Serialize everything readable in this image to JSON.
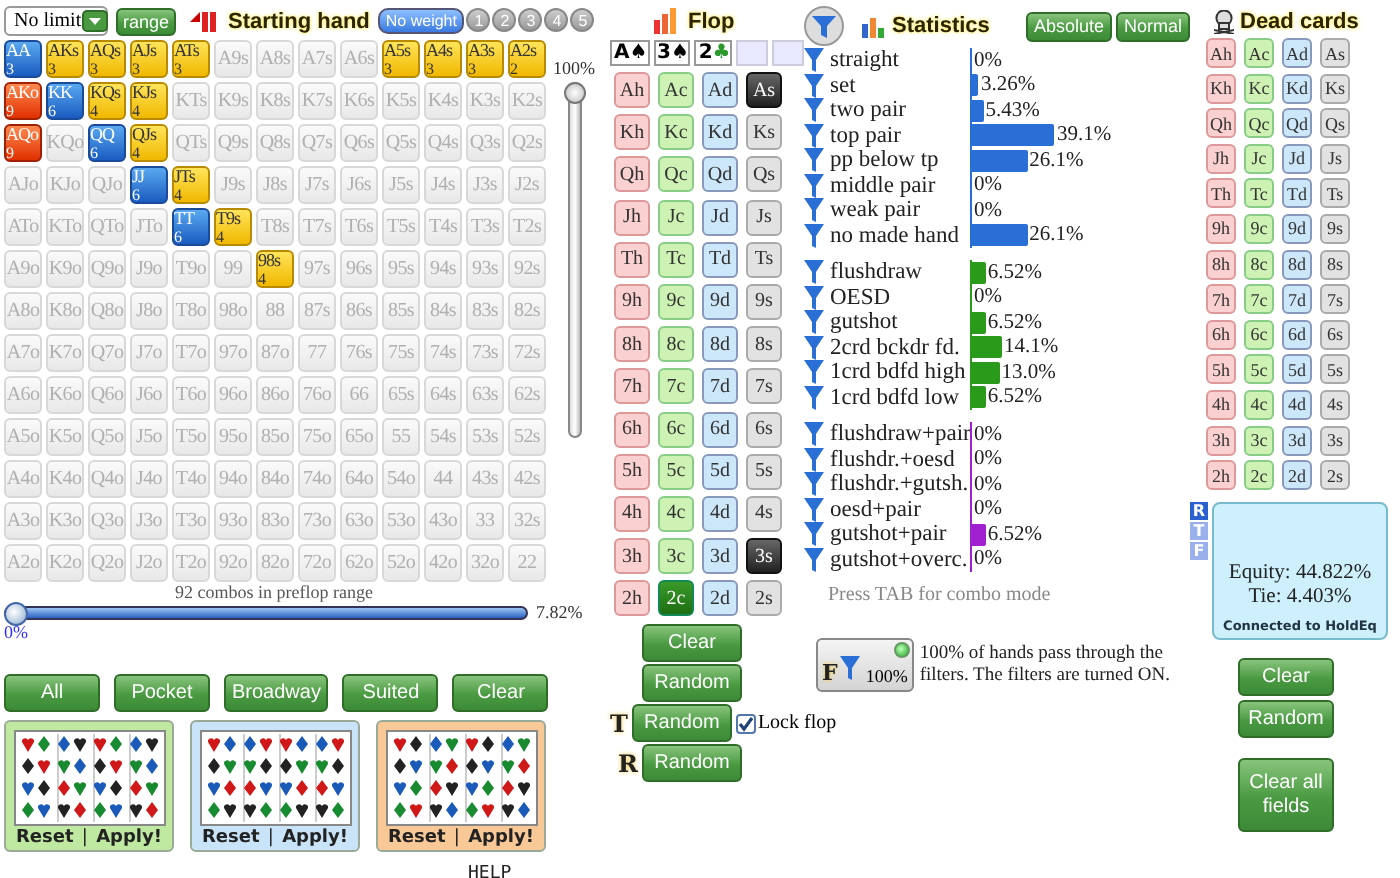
{
  "range": {
    "game": "No limit",
    "range_button": "range",
    "title": "Starting hand",
    "weights": [
      {
        "label": "No weight",
        "selected": true
      },
      {
        "label": "1",
        "selected": false
      },
      {
        "label": "2",
        "selected": false
      },
      {
        "label": "3",
        "selected": false
      },
      {
        "label": "4",
        "selected": false
      },
      {
        "label": "5",
        "selected": false
      }
    ],
    "grid": [
      [
        {
          "label": "AA",
          "selected": true,
          "count": "3"
        },
        {
          "label": "AKs",
          "selected": true,
          "count": "3"
        },
        {
          "label": "AQs",
          "selected": true,
          "count": "3"
        },
        {
          "label": "AJs",
          "selected": true,
          "count": "3"
        },
        {
          "label": "ATs",
          "selected": true,
          "count": "3"
        },
        {
          "label": "A9s",
          "selected": false
        },
        {
          "label": "A8s",
          "selected": false
        },
        {
          "label": "A7s",
          "selected": false
        },
        {
          "label": "A6s",
          "selected": false
        },
        {
          "label": "A5s",
          "selected": true,
          "count": "3"
        },
        {
          "label": "A4s",
          "selected": true,
          "count": "3"
        },
        {
          "label": "A3s",
          "selected": true,
          "count": "3"
        },
        {
          "label": "A2s",
          "selected": true,
          "count": "2"
        }
      ],
      [
        {
          "label": "AKo",
          "selected": true,
          "count": "9"
        },
        {
          "label": "KK",
          "selected": true,
          "count": "6"
        },
        {
          "label": "KQs",
          "selected": true,
          "count": "4"
        },
        {
          "label": "KJs",
          "selected": true,
          "count": "4"
        },
        {
          "label": "KTs",
          "selected": false
        },
        {
          "label": "K9s",
          "selected": false
        },
        {
          "label": "K8s",
          "selected": false
        },
        {
          "label": "K7s",
          "selected": false
        },
        {
          "label": "K6s",
          "selected": false
        },
        {
          "label": "K5s",
          "selected": false
        },
        {
          "label": "K4s",
          "selected": false
        },
        {
          "label": "K3s",
          "selected": false
        },
        {
          "label": "K2s",
          "selected": false
        }
      ],
      [
        {
          "label": "AQo",
          "selected": true,
          "count": "9"
        },
        {
          "label": "KQo",
          "selected": false
        },
        {
          "label": "QQ",
          "selected": true,
          "count": "6"
        },
        {
          "label": "QJs",
          "selected": true,
          "count": "4"
        },
        {
          "label": "QTs",
          "selected": false
        },
        {
          "label": "Q9s",
          "selected": false
        },
        {
          "label": "Q8s",
          "selected": false
        },
        {
          "label": "Q7s",
          "selected": false
        },
        {
          "label": "Q6s",
          "selected": false
        },
        {
          "label": "Q5s",
          "selected": false
        },
        {
          "label": "Q4s",
          "selected": false
        },
        {
          "label": "Q3s",
          "selected": false
        },
        {
          "label": "Q2s",
          "selected": false
        }
      ],
      [
        {
          "label": "AJo",
          "selected": false
        },
        {
          "label": "KJo",
          "selected": false
        },
        {
          "label": "QJo",
          "selected": false
        },
        {
          "label": "JJ",
          "selected": true,
          "count": "6"
        },
        {
          "label": "JTs",
          "selected": true,
          "count": "4"
        },
        {
          "label": "J9s",
          "selected": false
        },
        {
          "label": "J8s",
          "selected": false
        },
        {
          "label": "J7s",
          "selected": false
        },
        {
          "label": "J6s",
          "selected": false
        },
        {
          "label": "J5s",
          "selected": false
        },
        {
          "label": "J4s",
          "selected": false
        },
        {
          "label": "J3s",
          "selected": false
        },
        {
          "label": "J2s",
          "selected": false
        }
      ],
      [
        {
          "label": "ATo",
          "selected": false
        },
        {
          "label": "KTo",
          "selected": false
        },
        {
          "label": "QTo",
          "selected": false
        },
        {
          "label": "JTo",
          "selected": false
        },
        {
          "label": "TT",
          "selected": true,
          "count": "6"
        },
        {
          "label": "T9s",
          "selected": true,
          "count": "4"
        },
        {
          "label": "T8s",
          "selected": false
        },
        {
          "label": "T7s",
          "selected": false
        },
        {
          "label": "T6s",
          "selected": false
        },
        {
          "label": "T5s",
          "selected": false
        },
        {
          "label": "T4s",
          "selected": false
        },
        {
          "label": "T3s",
          "selected": false
        },
        {
          "label": "T2s",
          "selected": false
        }
      ],
      [
        {
          "label": "A9o",
          "selected": false
        },
        {
          "label": "K9o",
          "selected": false
        },
        {
          "label": "Q9o",
          "selected": false
        },
        {
          "label": "J9o",
          "selected": false
        },
        {
          "label": "T9o",
          "selected": false
        },
        {
          "label": "99",
          "selected": false
        },
        {
          "label": "98s",
          "selected": true,
          "count": "4"
        },
        {
          "label": "97s",
          "selected": false
        },
        {
          "label": "96s",
          "selected": false
        },
        {
          "label": "95s",
          "selected": false
        },
        {
          "label": "94s",
          "selected": false
        },
        {
          "label": "93s",
          "selected": false
        },
        {
          "label": "92s",
          "selected": false
        }
      ],
      [
        {
          "label": "A8o",
          "selected": false
        },
        {
          "label": "K8o",
          "selected": false
        },
        {
          "label": "Q8o",
          "selected": false
        },
        {
          "label": "J8o",
          "selected": false
        },
        {
          "label": "T8o",
          "selected": false
        },
        {
          "label": "98o",
          "selected": false
        },
        {
          "label": "88",
          "selected": false
        },
        {
          "label": "87s",
          "selected": false
        },
        {
          "label": "86s",
          "selected": false
        },
        {
          "label": "85s",
          "selected": false
        },
        {
          "label": "84s",
          "selected": false
        },
        {
          "label": "83s",
          "selected": false
        },
        {
          "label": "82s",
          "selected": false
        }
      ],
      [
        {
          "label": "A7o",
          "selected": false
        },
        {
          "label": "K7o",
          "selected": false
        },
        {
          "label": "Q7o",
          "selected": false
        },
        {
          "label": "J7o",
          "selected": false
        },
        {
          "label": "T7o",
          "selected": false
        },
        {
          "label": "97o",
          "selected": false
        },
        {
          "label": "87o",
          "selected": false
        },
        {
          "label": "77",
          "selected": false
        },
        {
          "label": "76s",
          "selected": false
        },
        {
          "label": "75s",
          "selected": false
        },
        {
          "label": "74s",
          "selected": false
        },
        {
          "label": "73s",
          "selected": false
        },
        {
          "label": "72s",
          "selected": false
        }
      ],
      [
        {
          "label": "A6o",
          "selected": false
        },
        {
          "label": "K6o",
          "selected": false
        },
        {
          "label": "Q6o",
          "selected": false
        },
        {
          "label": "J6o",
          "selected": false
        },
        {
          "label": "T6o",
          "selected": false
        },
        {
          "label": "96o",
          "selected": false
        },
        {
          "label": "86o",
          "selected": false
        },
        {
          "label": "76o",
          "selected": false
        },
        {
          "label": "66",
          "selected": false
        },
        {
          "label": "65s",
          "selected": false
        },
        {
          "label": "64s",
          "selected": false
        },
        {
          "label": "63s",
          "selected": false
        },
        {
          "label": "62s",
          "selected": false
        }
      ],
      [
        {
          "label": "A5o",
          "selected": false
        },
        {
          "label": "K5o",
          "selected": false
        },
        {
          "label": "Q5o",
          "selected": false
        },
        {
          "label": "J5o",
          "selected": false
        },
        {
          "label": "T5o",
          "selected": false
        },
        {
          "label": "95o",
          "selected": false
        },
        {
          "label": "85o",
          "selected": false
        },
        {
          "label": "75o",
          "selected": false
        },
        {
          "label": "65o",
          "selected": false
        },
        {
          "label": "55",
          "selected": false
        },
        {
          "label": "54s",
          "selected": false
        },
        {
          "label": "53s",
          "selected": false
        },
        {
          "label": "52s",
          "selected": false
        }
      ],
      [
        {
          "label": "A4o",
          "selected": false
        },
        {
          "label": "K4o",
          "selected": false
        },
        {
          "label": "Q4o",
          "selected": false
        },
        {
          "label": "J4o",
          "selected": false
        },
        {
          "label": "T4o",
          "selected": false
        },
        {
          "label": "94o",
          "selected": false
        },
        {
          "label": "84o",
          "selected": false
        },
        {
          "label": "74o",
          "selected": false
        },
        {
          "label": "64o",
          "selected": false
        },
        {
          "label": "54o",
          "selected": false
        },
        {
          "label": "44",
          "selected": false
        },
        {
          "label": "43s",
          "selected": false
        },
        {
          "label": "42s",
          "selected": false
        }
      ],
      [
        {
          "label": "A3o",
          "selected": false
        },
        {
          "label": "K3o",
          "selected": false
        },
        {
          "label": "Q3o",
          "selected": false
        },
        {
          "label": "J3o",
          "selected": false
        },
        {
          "label": "T3o",
          "selected": false
        },
        {
          "label": "93o",
          "selected": false
        },
        {
          "label": "83o",
          "selected": false
        },
        {
          "label": "73o",
          "selected": false
        },
        {
          "label": "63o",
          "selected": false
        },
        {
          "label": "53o",
          "selected": false
        },
        {
          "label": "43o",
          "selected": false
        },
        {
          "label": "33",
          "selected": false
        },
        {
          "label": "32s",
          "selected": false
        }
      ],
      [
        {
          "label": "A2o",
          "selected": false
        },
        {
          "label": "K2o",
          "selected": false
        },
        {
          "label": "Q2o",
          "selected": false
        },
        {
          "label": "J2o",
          "selected": false
        },
        {
          "label": "T2o",
          "selected": false
        },
        {
          "label": "92o",
          "selected": false
        },
        {
          "label": "82o",
          "selected": false
        },
        {
          "label": "72o",
          "selected": false
        },
        {
          "label": "62o",
          "selected": false
        },
        {
          "label": "52o",
          "selected": false
        },
        {
          "label": "42o",
          "selected": false
        },
        {
          "label": "32o",
          "selected": false
        },
        {
          "label": "22",
          "selected": false
        }
      ]
    ],
    "vertical_slider": {
      "label": "100%",
      "level": 1
    },
    "combos": "92 combos in preflop range",
    "slider": {
      "level": 0,
      "min_label": "0%",
      "max_label": "7.82%"
    },
    "buttons": [
      "All",
      "Pocket",
      "Broadway",
      "Suited",
      "Clear"
    ],
    "presets": [
      {
        "color": "#bfe8a0",
        "reset": "Reset",
        "separator": "|",
        "apply": "Apply!"
      },
      {
        "color": "#c9e4f8",
        "reset": "Reset",
        "separator": "|",
        "apply": "Apply!"
      },
      {
        "color": "#f8c896",
        "reset": "Reset",
        "separator": "|",
        "apply": "Apply!"
      }
    ],
    "help": "HELP"
  },
  "flop": {
    "title": "Flop",
    "board": [
      {
        "kind": "card",
        "rank": "A",
        "suit": "♠",
        "color": "#000000"
      },
      {
        "kind": "card",
        "rank": "3",
        "suit": "♠",
        "color": "#000000"
      },
      {
        "kind": "card",
        "rank": "2",
        "suit": "♣",
        "color": "#2a9a2a"
      },
      {
        "kind": "empty"
      },
      {
        "kind": "empty"
      }
    ],
    "cards": [
      [
        {
          "label": "Ah",
          "selected": false
        },
        {
          "label": "Ac",
          "selected": false
        },
        {
          "label": "Ad",
          "selected": false
        },
        {
          "label": "As",
          "selected": true
        }
      ],
      [
        {
          "label": "Kh",
          "selected": false
        },
        {
          "label": "Kc",
          "selected": false
        },
        {
          "label": "Kd",
          "selected": false
        },
        {
          "label": "Ks",
          "selected": false
        }
      ],
      [
        {
          "label": "Qh",
          "selected": false
        },
        {
          "label": "Qc",
          "selected": false
        },
        {
          "label": "Qd",
          "selected": false
        },
        {
          "label": "Qs",
          "selected": false
        }
      ],
      [
        {
          "label": "Jh",
          "selected": false
        },
        {
          "label": "Jc",
          "selected": false
        },
        {
          "label": "Jd",
          "selected": false
        },
        {
          "label": "Js",
          "selected": false
        }
      ],
      [
        {
          "label": "Th",
          "selected": false
        },
        {
          "label": "Tc",
          "selected": false
        },
        {
          "label": "Td",
          "selected": false
        },
        {
          "label": "Ts",
          "selected": false
        }
      ],
      [
        {
          "label": "9h",
          "selected": false
        },
        {
          "label": "9c",
          "selected": false
        },
        {
          "label": "9d",
          "selected": false
        },
        {
          "label": "9s",
          "selected": false
        }
      ],
      [
        {
          "label": "8h",
          "selected": false
        },
        {
          "label": "8c",
          "selected": false
        },
        {
          "label": "8d",
          "selected": false
        },
        {
          "label": "8s",
          "selected": false
        }
      ],
      [
        {
          "label": "7h",
          "selected": false
        },
        {
          "label": "7c",
          "selected": false
        },
        {
          "label": "7d",
          "selected": false
        },
        {
          "label": "7s",
          "selected": false
        }
      ],
      [
        {
          "label": "6h",
          "selected": false
        },
        {
          "label": "6c",
          "selected": false
        },
        {
          "label": "6d",
          "selected": false
        },
        {
          "label": "6s",
          "selected": false
        }
      ],
      [
        {
          "label": "5h",
          "selected": false
        },
        {
          "label": "5c",
          "selected": false
        },
        {
          "label": "5d",
          "selected": false
        },
        {
          "label": "5s",
          "selected": false
        }
      ],
      [
        {
          "label": "4h",
          "selected": false
        },
        {
          "label": "4c",
          "selected": false
        },
        {
          "label": "4d",
          "selected": false
        },
        {
          "label": "4s",
          "selected": false
        }
      ],
      [
        {
          "label": "3h",
          "selected": false
        },
        {
          "label": "3c",
          "selected": false
        },
        {
          "label": "3d",
          "selected": false
        },
        {
          "label": "3s",
          "selected": true
        }
      ],
      [
        {
          "label": "2h",
          "selected": false
        },
        {
          "label": "2c",
          "selected": true
        },
        {
          "label": "2d",
          "selected": false
        },
        {
          "label": "2s",
          "selected": false
        }
      ]
    ],
    "clear": "Clear",
    "random": "Random",
    "turn": {
      "tag": "T",
      "label": "Random"
    },
    "river": {
      "tag": "R",
      "label": "Random"
    },
    "lock": {
      "label": "Lock flop",
      "checked": true
    }
  },
  "stats": {
    "title": "Statistics",
    "modes": [
      "Absolute",
      "Normal"
    ],
    "groups": [
      {
        "color": "#2a6fd6",
        "rows": [
          {
            "label": "straight",
            "value": "0%",
            "level": 0
          },
          {
            "label": "set",
            "value": "3.26%",
            "level": 0.0326
          },
          {
            "label": "two pair",
            "value": "5.43%",
            "level": 0.0543
          },
          {
            "label": "top pair",
            "value": "39.1%",
            "level": 0.391
          },
          {
            "label": "pp below tp",
            "value": "26.1%",
            "level": 0.261
          },
          {
            "label": "middle pair",
            "value": "0%",
            "level": 0
          },
          {
            "label": "weak pair",
            "value": "0%",
            "level": 0
          },
          {
            "label": "no made hand",
            "value": "26.1%",
            "level": 0.261
          }
        ]
      },
      {
        "color": "#2a9a1a",
        "rows": [
          {
            "label": "flushdraw",
            "value": "6.52%",
            "level": 0.0652
          },
          {
            "label": "OESD",
            "value": "0%",
            "level": 0
          },
          {
            "label": "gutshot",
            "value": "6.52%",
            "level": 0.0652
          },
          {
            "label": "2crd bckdr fd.",
            "value": "14.1%",
            "level": 0.141
          },
          {
            "label": "1crd bdfd high",
            "value": "13.0%",
            "level": 0.13
          },
          {
            "label": "1crd bdfd low",
            "value": "6.52%",
            "level": 0.0652
          }
        ]
      },
      {
        "color": "#a020d0",
        "rows": [
          {
            "label": "flushdraw+pair",
            "value": "0%",
            "level": 0
          },
          {
            "label": "flushdr.+oesd",
            "value": "0%",
            "level": 0
          },
          {
            "label": "flushdr.+gutsh.",
            "value": "0%",
            "level": 0
          },
          {
            "label": "oesd+pair",
            "value": "0%",
            "level": 0
          },
          {
            "label": "gutshot+pair",
            "value": "6.52%",
            "level": 0.0652
          },
          {
            "label": "gutshot+overc.",
            "value": "0%",
            "level": 0
          }
        ]
      }
    ],
    "hint": "Press TAB for combo mode",
    "filter": {
      "tag": "F",
      "value": "100%",
      "on": true,
      "message": "100% of hands pass through the filters. The filters are turned ON."
    }
  },
  "dead": {
    "title": "Dead cards",
    "cards": [
      [
        {
          "label": "Ah",
          "selected": false
        },
        {
          "label": "Ac",
          "selected": false
        },
        {
          "label": "Ad",
          "selected": false
        },
        {
          "label": "As",
          "selected": false
        }
      ],
      [
        {
          "label": "Kh",
          "selected": false
        },
        {
          "label": "Kc",
          "selected": false
        },
        {
          "label": "Kd",
          "selected": false
        },
        {
          "label": "Ks",
          "selected": false
        }
      ],
      [
        {
          "label": "Qh",
          "selected": false
        },
        {
          "label": "Qc",
          "selected": false
        },
        {
          "label": "Qd",
          "selected": false
        },
        {
          "label": "Qs",
          "selected": false
        }
      ],
      [
        {
          "label": "Jh",
          "selected": false
        },
        {
          "label": "Jc",
          "selected": false
        },
        {
          "label": "Jd",
          "selected": false
        },
        {
          "label": "Js",
          "selected": false
        }
      ],
      [
        {
          "label": "Th",
          "selected": false
        },
        {
          "label": "Tc",
          "selected": false
        },
        {
          "label": "Td",
          "selected": false
        },
        {
          "label": "Ts",
          "selected": false
        }
      ],
      [
        {
          "label": "9h",
          "selected": false
        },
        {
          "label": "9c",
          "selected": false
        },
        {
          "label": "9d",
          "selected": false
        },
        {
          "label": "9s",
          "selected": false
        }
      ],
      [
        {
          "label": "8h",
          "selected": false
        },
        {
          "label": "8c",
          "selected": false
        },
        {
          "label": "8d",
          "selected": false
        },
        {
          "label": "8s",
          "selected": false
        }
      ],
      [
        {
          "label": "7h",
          "selected": false
        },
        {
          "label": "7c",
          "selected": false
        },
        {
          "label": "7d",
          "selected": false
        },
        {
          "label": "7s",
          "selected": false
        }
      ],
      [
        {
          "label": "6h",
          "selected": false
        },
        {
          "label": "6c",
          "selected": false
        },
        {
          "label": "6d",
          "selected": false
        },
        {
          "label": "6s",
          "selected": false
        }
      ],
      [
        {
          "label": "5h",
          "selected": false
        },
        {
          "label": "5c",
          "selected": false
        },
        {
          "label": "5d",
          "selected": false
        },
        {
          "label": "5s",
          "selected": false
        }
      ],
      [
        {
          "label": "4h",
          "selected": false
        },
        {
          "label": "4c",
          "selected": false
        },
        {
          "label": "4d",
          "selected": false
        },
        {
          "label": "4s",
          "selected": false
        }
      ],
      [
        {
          "label": "3h",
          "selected": false
        },
        {
          "label": "3c",
          "selected": false
        },
        {
          "label": "3d",
          "selected": false
        },
        {
          "label": "3s",
          "selected": false
        }
      ],
      [
        {
          "label": "2h",
          "selected": false
        },
        {
          "label": "2c",
          "selected": false
        },
        {
          "label": "2d",
          "selected": false
        },
        {
          "label": "2s",
          "selected": false
        }
      ]
    ],
    "street_tabs": [
      {
        "label": "R",
        "selected": true
      },
      {
        "label": "T",
        "selected": false
      },
      {
        "label": "F",
        "selected": false
      }
    ],
    "equity": "Equity: 44.822%",
    "tie": "Tie: 4.403%",
    "status": "Connected to HoldEq",
    "buttons": [
      "Clear",
      "Random",
      "Clear all fields"
    ]
  }
}
